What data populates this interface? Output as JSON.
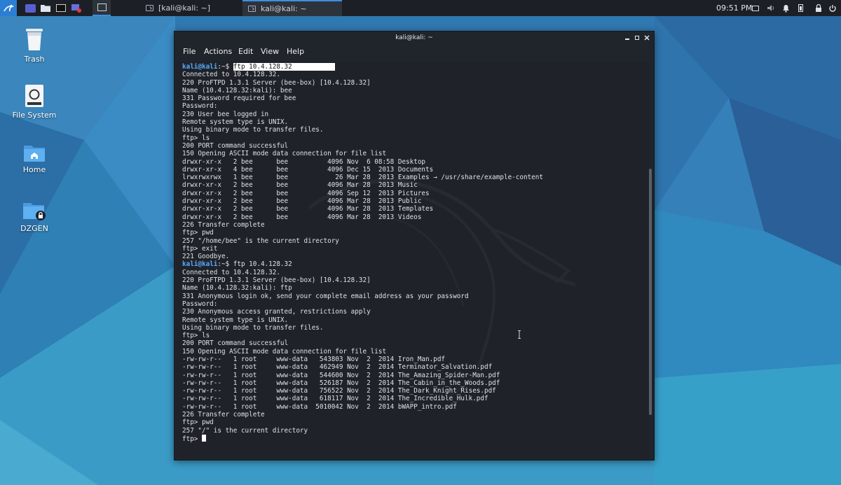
{
  "taskbar": {
    "tasks": [
      {
        "label": "[kali@kali: ~]",
        "active": false
      },
      {
        "label": "kali@kali: ~",
        "active": true
      }
    ],
    "clock": "09:51 PM",
    "icons": [
      "kali-menu-icon",
      "workspace-icon",
      "files-icon",
      "terminal-icon",
      "recorder-icon",
      "terminal-small-icon",
      "display-icon",
      "volume-icon",
      "notification-icon",
      "battery-icon",
      "power-icon",
      "lock-icon",
      "power-off-icon"
    ]
  },
  "desktop": {
    "icons": [
      {
        "label": "Trash",
        "icon": "trash-icon"
      },
      {
        "label": "File System",
        "icon": "drive-icon"
      },
      {
        "label": "Home",
        "icon": "home-folder-icon"
      },
      {
        "label": "DZGEN",
        "icon": "locked-folder-icon"
      }
    ]
  },
  "terminal": {
    "title": "kali@kali: ~",
    "menu": [
      "File",
      "Actions",
      "Edit",
      "View",
      "Help"
    ],
    "prompt_user": "kali@kali",
    "prompt_path": ":~$ ",
    "lines": [
      {
        "kind": "prompt",
        "cmd": "ftp 10.4.128.32",
        "highlight": true
      },
      {
        "text": "Connected to 10.4.128.32."
      },
      {
        "text": "220 ProFTPD 1.3.1 Server (bee-box) [10.4.128.32]"
      },
      {
        "text": "Name (10.4.128.32:kali): bee"
      },
      {
        "text": "331 Password required for bee"
      },
      {
        "text": "Password:"
      },
      {
        "text": "230 User bee logged in"
      },
      {
        "text": "Remote system type is UNIX."
      },
      {
        "text": "Using binary mode to transfer files."
      },
      {
        "text": "ftp> ls"
      },
      {
        "text": "200 PORT command successful"
      },
      {
        "text": "150 Opening ASCII mode data connection for file list"
      },
      {
        "text": "drwxr-xr-x   2 bee      bee          4096 Nov  6 08:58 Desktop"
      },
      {
        "text": "drwxr-xr-x   4 bee      bee          4096 Dec 15  2013 Documents"
      },
      {
        "text": "lrwxrwxrwx   1 bee      bee            26 Mar 28  2013 Examples → /usr/share/example-content"
      },
      {
        "text": "drwxr-xr-x   2 bee      bee          4096 Mar 28  2013 Music"
      },
      {
        "text": "drwxr-xr-x   2 bee      bee          4096 Sep 12  2013 Pictures"
      },
      {
        "text": "drwxr-xr-x   2 bee      bee          4096 Mar 28  2013 Public"
      },
      {
        "text": "drwxr-xr-x   2 bee      bee          4096 Mar 28  2013 Templates"
      },
      {
        "text": "drwxr-xr-x   2 bee      bee          4096 Mar 28  2013 Videos"
      },
      {
        "text": "226 Transfer complete"
      },
      {
        "text": "ftp> pwd"
      },
      {
        "text": "257 \"/home/bee\" is the current directory"
      },
      {
        "text": "ftp> exit"
      },
      {
        "text": "221 Goodbye."
      },
      {
        "kind": "prompt",
        "cmd": "ftp 10.4.128.32",
        "highlight": false
      },
      {
        "text": "Connected to 10.4.128.32."
      },
      {
        "text": "220 ProFTPD 1.3.1 Server (bee-box) [10.4.128.32]"
      },
      {
        "text": "Name (10.4.128.32:kali): ftp"
      },
      {
        "text": "331 Anonymous login ok, send your complete email address as your password"
      },
      {
        "text": "Password:"
      },
      {
        "text": "230 Anonymous access granted, restrictions apply"
      },
      {
        "text": "Remote system type is UNIX."
      },
      {
        "text": "Using binary mode to transfer files."
      },
      {
        "text": "ftp> ls"
      },
      {
        "text": "200 PORT command successful"
      },
      {
        "text": "150 Opening ASCII mode data connection for file list"
      },
      {
        "text": "-rw-rw-r--   1 root     www-data   543803 Nov  2  2014 Iron_Man.pdf"
      },
      {
        "text": "-rw-rw-r--   1 root     www-data   462949 Nov  2  2014 Terminator_Salvation.pdf"
      },
      {
        "text": "-rw-rw-r--   1 root     www-data   544600 Nov  2  2014 The_Amazing_Spider-Man.pdf"
      },
      {
        "text": "-rw-rw-r--   1 root     www-data   526187 Nov  2  2014 The_Cabin_in_the_Woods.pdf"
      },
      {
        "text": "-rw-rw-r--   1 root     www-data   756522 Nov  2  2014 The_Dark_Knight_Rises.pdf"
      },
      {
        "text": "-rw-rw-r--   1 root     www-data   618117 Nov  2  2014 The_Incredible_Hulk.pdf"
      },
      {
        "text": "-rw-rw-r--   1 root     www-data  5010042 Nov  2  2014 bWAPP_intro.pdf"
      },
      {
        "text": "226 Transfer complete"
      },
      {
        "text": "ftp> pwd"
      },
      {
        "text": "257 \"/\" is the current directory"
      },
      {
        "kind": "input",
        "text": "ftp> "
      }
    ]
  },
  "colors": {
    "prompt": "#5aa9ff",
    "terminal_bg": "#1f2329",
    "taskbar_bg": "#1c2026"
  }
}
